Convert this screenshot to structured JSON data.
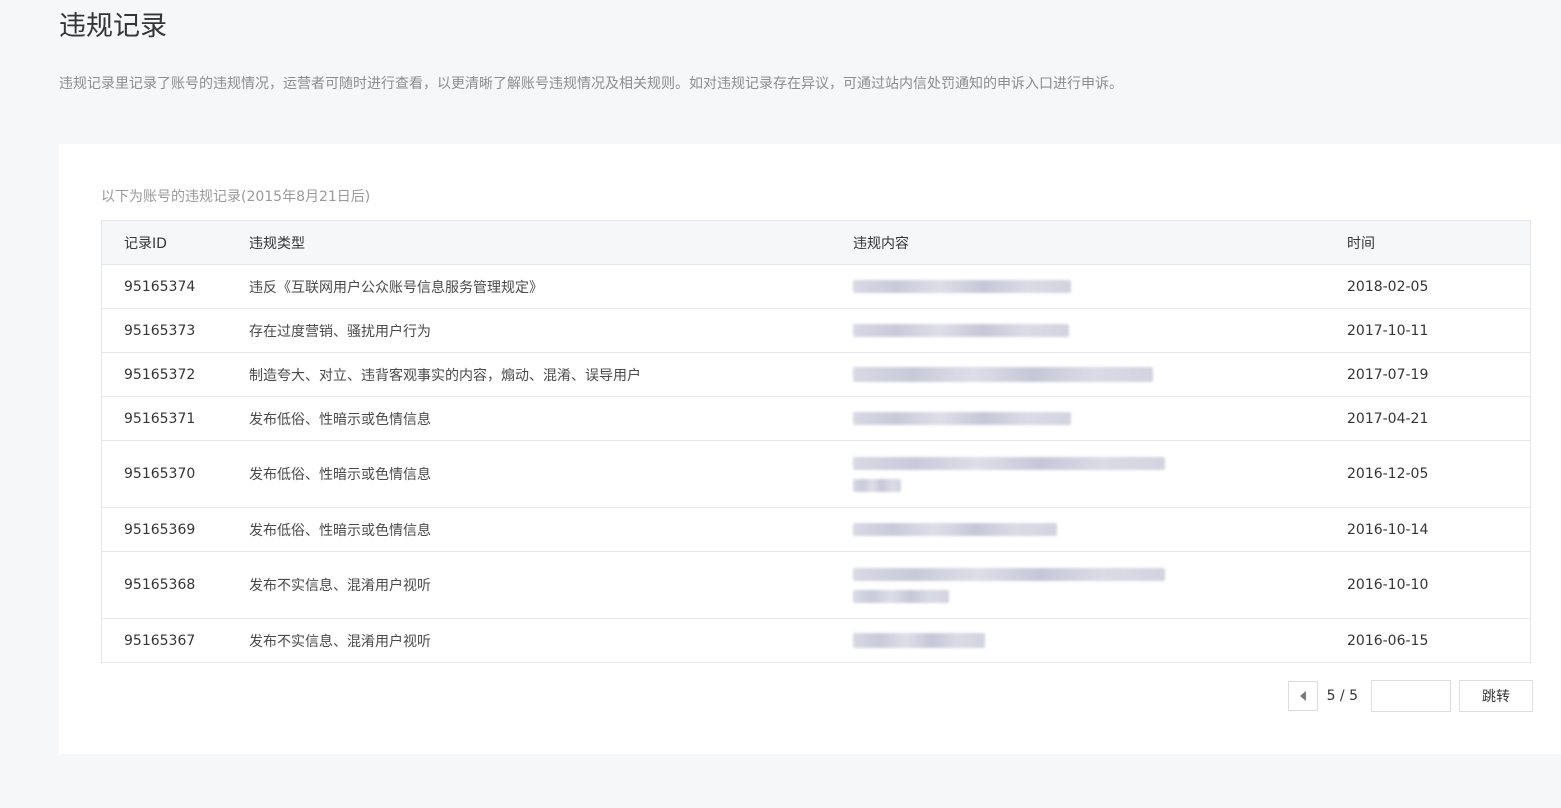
{
  "page": {
    "title": "违规记录",
    "description": "违规记录里记录了账号的违规情况，运营者可随时进行查看，以更清晰了解账号违规情况及相关规则。如对违规记录存在异议，可通过站内信处罚通知的申诉入口进行申诉。"
  },
  "table": {
    "caption": "以下为账号的违规记录(2015年8月21日后)",
    "headers": {
      "id": "记录ID",
      "type": "违规类型",
      "content": "违规内容",
      "time": "时间"
    },
    "rows": [
      {
        "id": "95165374",
        "type": "违反《互联网用户公众账号信息服务管理规定》",
        "time": "2018-02-05"
      },
      {
        "id": "95165373",
        "type": "存在过度营销、骚扰用户行为",
        "time": "2017-10-11"
      },
      {
        "id": "95165372",
        "type": "制造夸大、对立、违背客观事实的内容，煽动、混淆、误导用户",
        "time": "2017-07-19"
      },
      {
        "id": "95165371",
        "type": "发布低俗、性暗示或色情信息",
        "time": "2017-04-21"
      },
      {
        "id": "95165370",
        "type": "发布低俗、性暗示或色情信息",
        "time": "2016-12-05"
      },
      {
        "id": "95165369",
        "type": "发布低俗、性暗示或色情信息",
        "time": "2016-10-14"
      },
      {
        "id": "95165368",
        "type": "发布不实信息、混淆用户视听",
        "time": "2016-10-10"
      },
      {
        "id": "95165367",
        "type": "发布不实信息、混淆用户视听",
        "time": "2016-06-15"
      }
    ]
  },
  "pagination": {
    "page_indicator": "5 / 5",
    "jump_input_value": "",
    "jump_label": "跳转"
  }
}
